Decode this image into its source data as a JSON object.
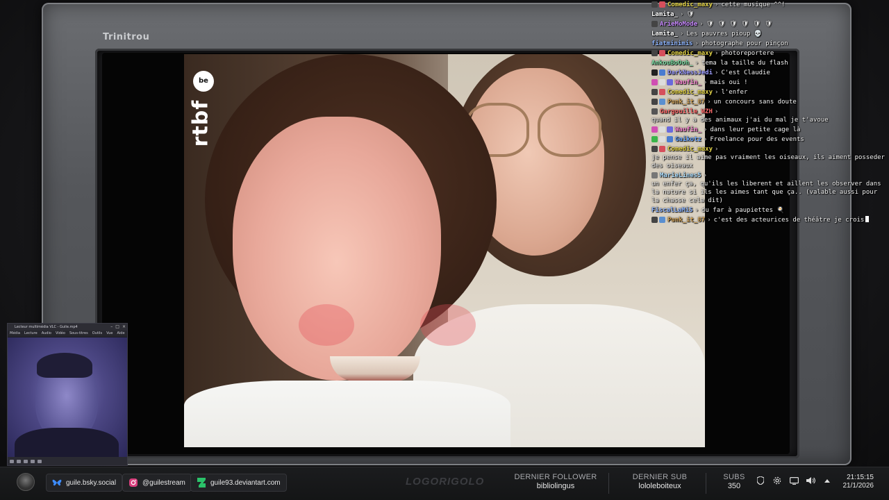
{
  "tv": {
    "brand": "Trinitrou"
  },
  "video": {
    "channel_logo": "rtbf",
    "channel_logo_suffix": "be"
  },
  "chat": {
    "messages": [
      {
        "user": "Comedic_maxy",
        "color": "#e8d84a",
        "badges": [
          "#444",
          "#d64f5c"
        ],
        "text": "cette musique ^^!"
      },
      {
        "user": "Lamita_",
        "color": "#ffffff",
        "badges": [],
        "text": "🛡"
      },
      {
        "user": "ArieMoMode",
        "color": "#c98bff",
        "badges": [
          "#444"
        ],
        "text": "🛡 🛡 🛡 🛡 🛡 🛡"
      },
      {
        "user": "Lamita_",
        "color": "#ffffff",
        "badges": [],
        "text": "Les pauvres pioup 💀"
      },
      {
        "user": "fiatminimis",
        "color": "#8fb6ff",
        "badges": [],
        "text": "photographe pour pinçon"
      },
      {
        "user": "Comedic_maxy",
        "color": "#e8d84a",
        "badges": [
          "#444",
          "#d64f5c"
        ],
        "text": "photoreportere"
      },
      {
        "user": "AnkouBoOoh_",
        "color": "#7ee0a6",
        "badges": [],
        "text": "tema la taille du flash"
      },
      {
        "user": "DarkNessJedi",
        "color": "#9d9dff",
        "badges": [
          "#222",
          "#4a7bd0"
        ],
        "text": "C'est Claudie"
      },
      {
        "user": "Waufin_",
        "color": "#ff8ad8",
        "badges": [
          "#d04fb3",
          "#ddd",
          "#6a6adc"
        ],
        "text": "mais oui !"
      },
      {
        "user": "Comedic_maxy",
        "color": "#e8d84a",
        "badges": [
          "#444",
          "#d64f5c"
        ],
        "text": "l'enfer"
      },
      {
        "user": "Punk_it_87",
        "color": "#d7a85c",
        "badges": [
          "#444",
          "#5a8fd0"
        ],
        "text": "un concours sans doute"
      },
      {
        "user": "Gargouille_WZH",
        "color": "#ff6b6b",
        "badges": [
          "#555"
        ],
        "text": "quand il y a des animaux j'ai du mal je t'avoue"
      },
      {
        "user": "Waufin_",
        "color": "#ff8ad8",
        "badges": [
          "#d04fb3",
          "#ddd",
          "#6a6adc"
        ],
        "text": "dans leur petite cage là"
      },
      {
        "user": "Gaikotz",
        "color": "#6aa6ff",
        "badges": [
          "#3ab54a",
          "#ddd",
          "#4a7bd0"
        ],
        "text": "Freelance pour des events"
      },
      {
        "user": "Comedic_maxy",
        "color": "#e8d84a",
        "badges": [
          "#444",
          "#d64f5c"
        ],
        "text": "je pense il aime pas vraiment les oiseaux, ils aiment posseder des oiseaux"
      },
      {
        "user": "MarieLines5",
        "color": "#b0e0ff",
        "badges": [
          "#777"
        ],
        "text": "un enfer ça, qu'ils les liberent et aillent les observer dans la nature si ils les aimes tant que ça.. (valable aussi pour la chasse cela dit)"
      },
      {
        "user": "FiscalLaMiS",
        "color": "#8fb6ff",
        "badges": [],
        "text": "du far à paupiettes 🍳"
      },
      {
        "user": "Punk_it_87",
        "color": "#d7a85c",
        "badges": [
          "#444",
          "#5a8fd0"
        ],
        "text": "c'est des acteurices de théâtre je crois"
      }
    ]
  },
  "webcam": {
    "title": "Lecteur multimédia VLC - Guile.mp4",
    "menu": [
      "Média",
      "Lecture",
      "Audio",
      "Vidéo",
      "Sous-titres",
      "Outils",
      "Vue",
      "Aide"
    ]
  },
  "taskbar": {
    "bsky": "guile.bsky.social",
    "instagram": "@guilestream",
    "deviantart": "guile93.deviantart.com",
    "ghost_logo": "LOGORIGOLO",
    "follower_label": "DERNIER FOLLOWER",
    "follower_value": "bibliolingus",
    "sub_label": "DERNIER SUB",
    "sub_value": "lololeboiteux",
    "subs_label": "SUBS",
    "subs_value": "350",
    "time": "21:15:15",
    "date": "21/1/2026",
    "tray_icons": [
      "shield-icon",
      "settings-icon",
      "monitor-icon",
      "volume-icon",
      "chevron-up-icon"
    ]
  }
}
